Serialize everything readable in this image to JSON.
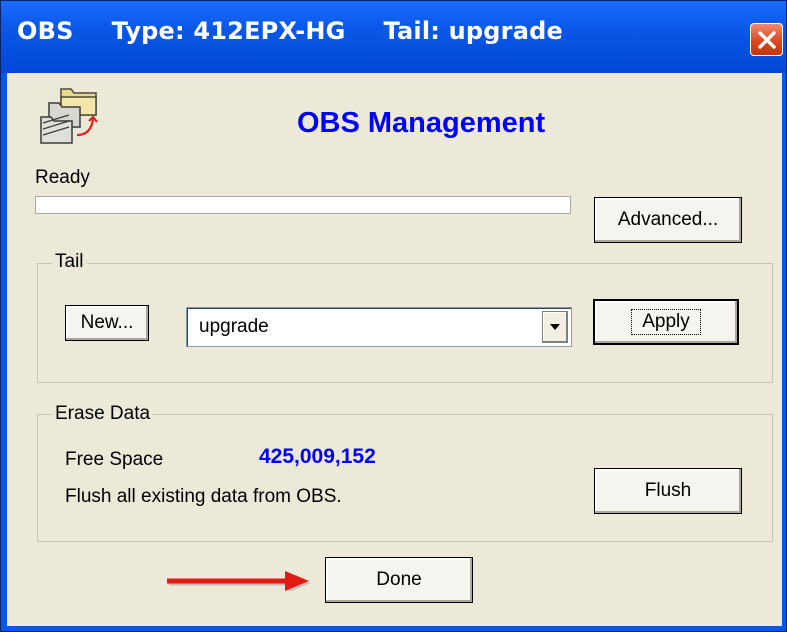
{
  "titlebar": {
    "app": "OBS",
    "type": "Type: 412EPX-HG",
    "tail": "Tail: upgrade",
    "close_icon": "close-x-icon"
  },
  "header": {
    "icon": "folders-sync-icon",
    "heading": "OBS Management"
  },
  "status": {
    "text": "Ready",
    "progress": 0
  },
  "buttons": {
    "advanced": "Advanced...",
    "new": "New...",
    "apply": "Apply",
    "flush": "Flush",
    "done": "Done"
  },
  "tail_group": {
    "title": "Tail",
    "selected": "upgrade"
  },
  "erase_group": {
    "title": "Erase Data",
    "free_space_label": "Free Space",
    "free_space_value": "425,009,152",
    "flush_description": "Flush all existing data from OBS."
  },
  "annotation": {
    "arrow_color": "#e21b12",
    "arrow_icon": "red-arrow-icon"
  },
  "colors": {
    "title_bar": "#0058ee",
    "heading": "#0000ff",
    "window_bg": "#ece9d8"
  }
}
